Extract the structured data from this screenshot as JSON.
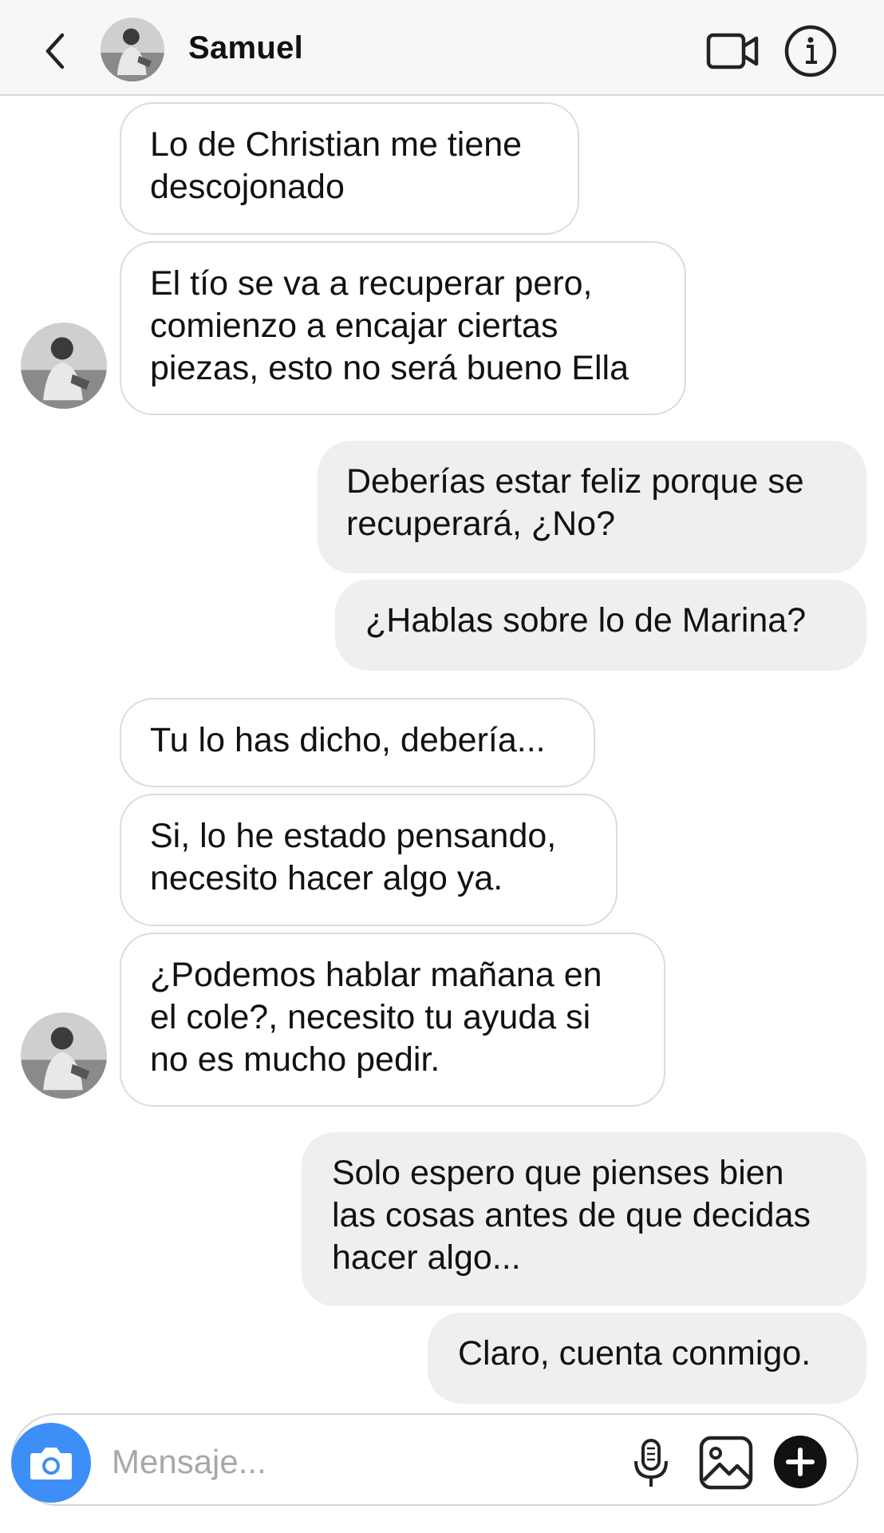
{
  "header": {
    "contact_name": "Samuel",
    "icons": [
      "chevron-left-icon",
      "video-camera-icon",
      "info-icon"
    ]
  },
  "messages": [
    {
      "side": "incoming",
      "text": "Lo de Christian me tiene\ndescojonado"
    },
    {
      "side": "incoming",
      "text": "El tío se va a recuperar pero,\ncomienzo a encajar ciertas\npiezas, esto no será bueno Ella"
    },
    {
      "side": "outgoing",
      "text": "Deberías estar feliz porque se\nrecuperará, ¿No?"
    },
    {
      "side": "outgoing",
      "text": "¿Hablas sobre lo de Marina?"
    },
    {
      "side": "incoming",
      "text": "Tu lo has dicho, debería..."
    },
    {
      "side": "incoming",
      "text": "Si, lo he estado pensando,\nnecesito hacer algo ya."
    },
    {
      "side": "incoming",
      "text": "¿Podemos hablar mañana en\nel cole?, necesito tu ayuda si\nno es mucho pedir."
    },
    {
      "side": "outgoing",
      "text": "Solo espero que pienses bien\nlas cosas antes de que decidas\nhacer algo..."
    },
    {
      "side": "outgoing",
      "text": "Claro, cuenta conmigo."
    }
  ],
  "composer": {
    "placeholder": "Mensaje...",
    "icons": [
      "camera-icon",
      "microphone-icon",
      "gallery-icon",
      "plus-icon"
    ]
  },
  "colors": {
    "camera_button": "#3d8ff7",
    "outgoing_bubble": "#efefef",
    "incoming_border": "#dcdcdc"
  }
}
